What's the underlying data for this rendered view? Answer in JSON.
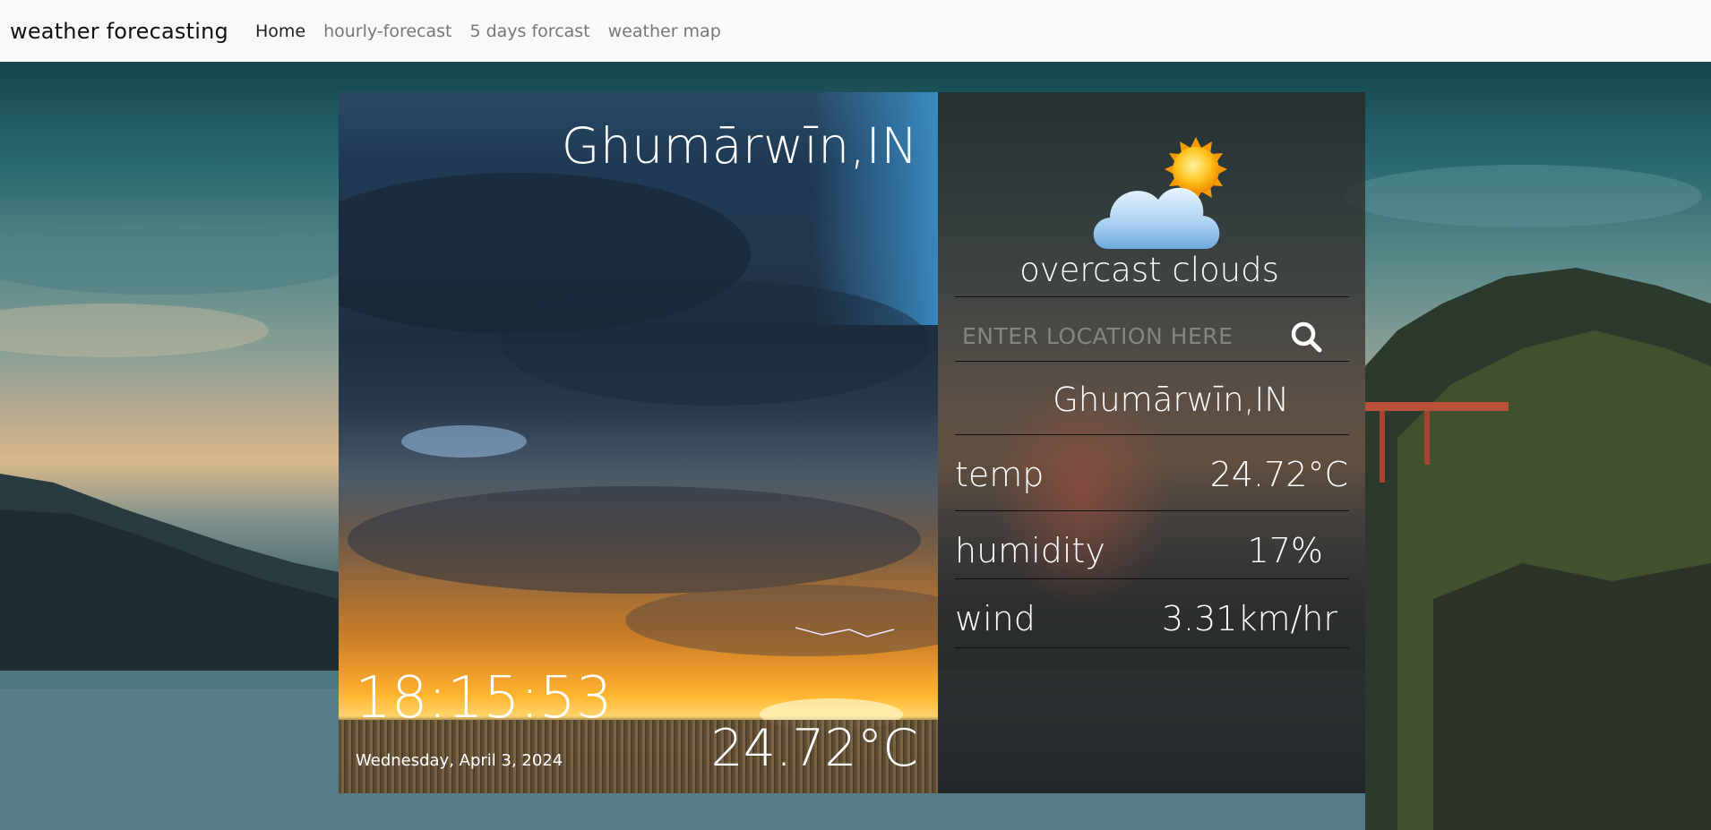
{
  "navbar": {
    "brand": "weather forecasting",
    "links": [
      "Home",
      "hourly-forecast",
      "5 days forcast",
      "weather map"
    ]
  },
  "photo": {
    "city": "Ghumārwīn,IN",
    "time": "18:15:53",
    "date": "Wednesday, April 3, 2024",
    "temp": "24.72°C"
  },
  "panel": {
    "condition": "overcast clouds",
    "search": {
      "placeholder": "ENTER LOCATION HERE"
    },
    "city": "Ghumārwīn,IN",
    "rows": [
      {
        "label": "temp",
        "value": "24.72°C"
      },
      {
        "label": "humidity",
        "value": "17%"
      },
      {
        "label": "wind",
        "value": "3.31km/hr"
      }
    ],
    "icon": "cloud-sun-icon"
  }
}
